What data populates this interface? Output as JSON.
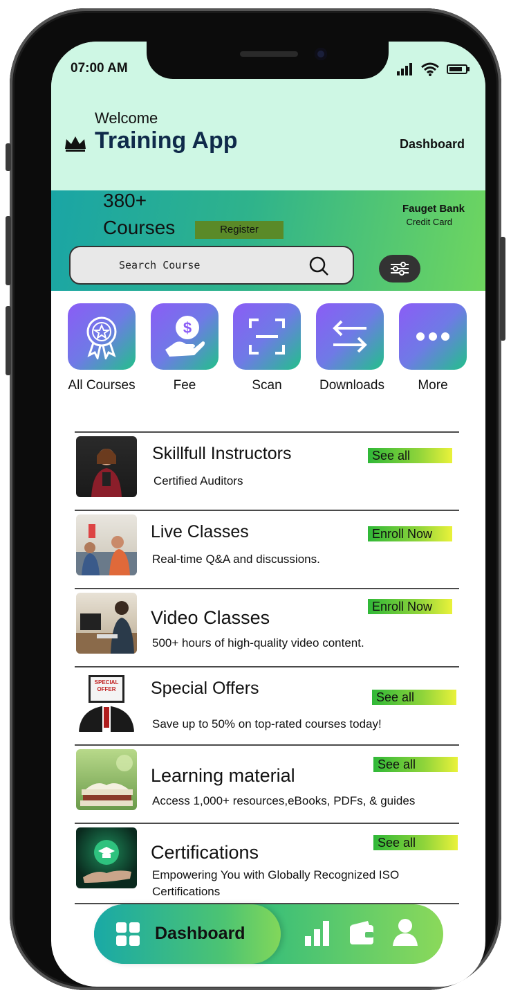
{
  "status": {
    "time": "07:00 AM"
  },
  "header": {
    "welcome": "Welcome",
    "app_title": "Training App",
    "dashboard_link": "Dashboard"
  },
  "banner": {
    "count": "380+",
    "courses": "Courses",
    "register": "Register",
    "bank_name": "Fauget Bank",
    "bank_card": "Credit Card",
    "search_placeholder": "Search Course"
  },
  "quick_actions": [
    {
      "label": "All Courses",
      "icon": "badge-icon"
    },
    {
      "label": "Fee",
      "icon": "hand-dollar-icon"
    },
    {
      "label": "Scan",
      "icon": "scan-icon"
    },
    {
      "label": "Downloads",
      "icon": "arrows-exchange-icon"
    },
    {
      "label": "More",
      "icon": "more-dots-icon"
    }
  ],
  "list": [
    {
      "title": "Skillfull Instructors",
      "subtitle": "Certified Auditors",
      "action": "See all"
    },
    {
      "title": "Live Classes",
      "subtitle": "Real-time Q&A and discussions.",
      "action": "Enroll Now"
    },
    {
      "title": "Video Classes",
      "subtitle": "500+ hours of high-quality video content.",
      "action": "Enroll Now"
    },
    {
      "title": "Special Offers",
      "subtitle": "Save up to 50% on top-rated courses today!",
      "action": "See all",
      "thumb_text": "SPECIAL OFFER"
    },
    {
      "title": "Learning material",
      "subtitle": "Access 1,000+ resources,eBooks, PDFs, & guides",
      "action": "See all"
    },
    {
      "title": "Certifications",
      "subtitle": "Empowering You with Globally Recognized ISO Certifications",
      "action": "See all"
    }
  ],
  "nav": {
    "active_label": "Dashboard"
  },
  "colors": {
    "header_bg": "#cef7e4",
    "title": "#0f2a4a",
    "accent_green": "#3bbf78",
    "accent_purple": "#8b5cf6"
  }
}
